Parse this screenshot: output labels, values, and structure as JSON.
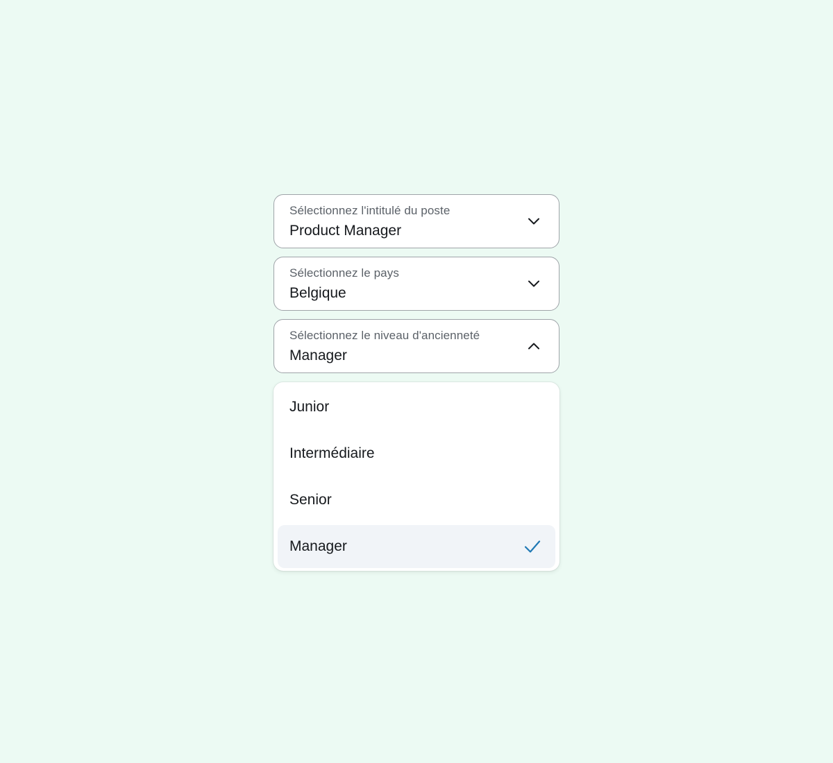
{
  "fields": [
    {
      "label": "Sélectionnez l'intitulé du poste",
      "value": "Product Manager",
      "state": "collapsed",
      "chevron_icon": "chevron-down-icon"
    },
    {
      "label": "Sélectionnez le pays",
      "value": "Belgique",
      "state": "collapsed",
      "chevron_icon": "chevron-down-icon"
    },
    {
      "label": "Sélectionnez le niveau d'ancienneté",
      "value": "Manager",
      "state": "expanded",
      "chevron_icon": "chevron-up-icon"
    }
  ],
  "dropdown": {
    "options": [
      {
        "label": "Junior",
        "selected": false
      },
      {
        "label": "Intermédiaire",
        "selected": false
      },
      {
        "label": "Senior",
        "selected": false
      },
      {
        "label": "Manager",
        "selected": true
      }
    ],
    "selected_icon": "checkmark-icon"
  },
  "colors": {
    "background": "#ecfaf3",
    "border": "#9ea3a8",
    "text": "#16191d",
    "label_text": "#5b6168",
    "selected_row": "#f1f4f8",
    "check_accent": "#1f78b4"
  }
}
